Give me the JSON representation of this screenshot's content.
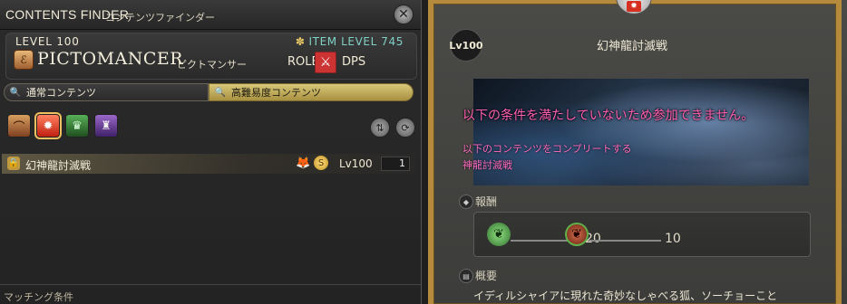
{
  "left": {
    "title": "CONTENTS FINDER",
    "title_jp": "コンテンツファインダー",
    "level": "LEVEL 100",
    "item_level": "ITEM LEVEL 745",
    "job_name": "PICTOMANCER",
    "job_jp": "ピクトマンサー",
    "role_label": "ROLE",
    "role": "DPS",
    "tabs": [
      "通常コンテンツ",
      "高難易度コンテンツ"
    ],
    "duty": {
      "name": "幻神龍討滅戦",
      "level": "Lv100",
      "count": "1"
    },
    "matching": "マッチング条件"
  },
  "right": {
    "lv_badge": "Lv100",
    "duty_title": "幻神龍討滅戦",
    "banner_text": "以下の条件を満たしていないため参加できません。",
    "banner_sub1": "以下のコンテンツをコンプリートする",
    "banner_sub2": "神龍討滅戦",
    "reward_label": "報酬",
    "rewards": [
      {
        "amount": "20"
      },
      {
        "amount": "10"
      }
    ],
    "summary_label": "概要",
    "summary_text": "イディルシャイアに現れた奇妙なしゃべる狐、ソーチョーこと"
  },
  "icons": {
    "close": "gear-close-icon",
    "lock": "lock-icon",
    "search": "search-icon",
    "fox": "fox-icon",
    "coin": "coin-icon"
  }
}
